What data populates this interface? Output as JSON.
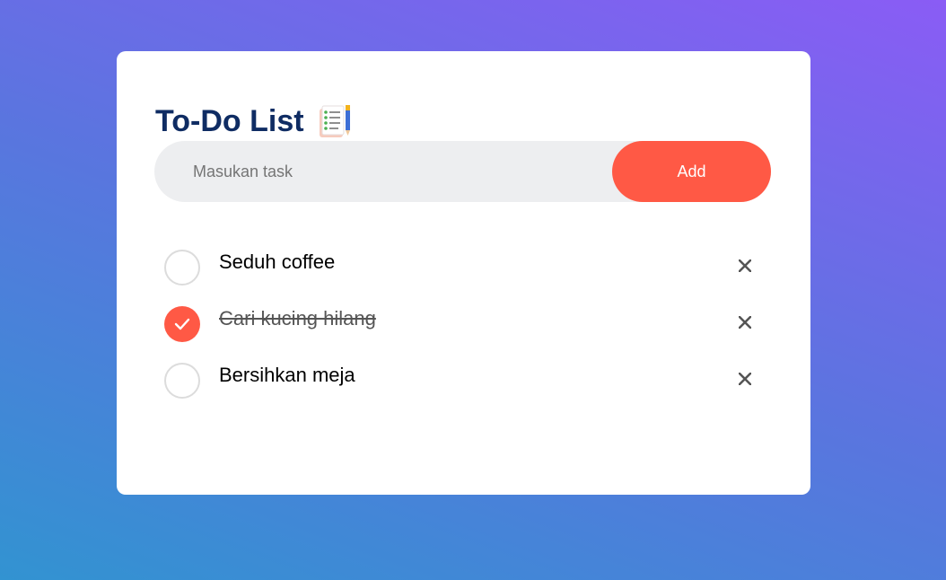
{
  "app": {
    "title": "To-Do List",
    "title_icon": "notepad-checklist-icon"
  },
  "input": {
    "value": "",
    "placeholder": "Masukan task"
  },
  "add_button": {
    "label": "Add"
  },
  "tasks": [
    {
      "text": "Seduh coffee",
      "done": false
    },
    {
      "text": "Cari kucing hilang",
      "done": true
    },
    {
      "text": "Bersihkan meja",
      "done": false
    }
  ],
  "colors": {
    "accent": "#ff5945",
    "title": "#0f2c63",
    "background_top": "#8a5cf5",
    "background_bottom": "#3293d1"
  }
}
